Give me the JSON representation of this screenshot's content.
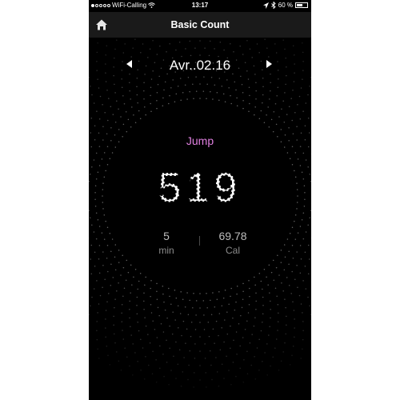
{
  "status_bar": {
    "carrier": "WiFi-Calling",
    "time": "13:17",
    "battery": "60 %",
    "battery_level": 0.6
  },
  "nav": {
    "title": "Basic Count",
    "home_icon": "home-icon"
  },
  "date": {
    "label": "Avr..02.16",
    "prev_icon": "triangle-left-icon",
    "next_icon": "triangle-right-icon"
  },
  "workout": {
    "mode": "Jump",
    "count": "519",
    "duration_value": "5",
    "duration_unit": "min",
    "calories_value": "69.78",
    "calories_unit": "Cal"
  },
  "colors": {
    "background": "#000000",
    "navbar": "#1a1a1a",
    "accent": "#e080e0"
  }
}
